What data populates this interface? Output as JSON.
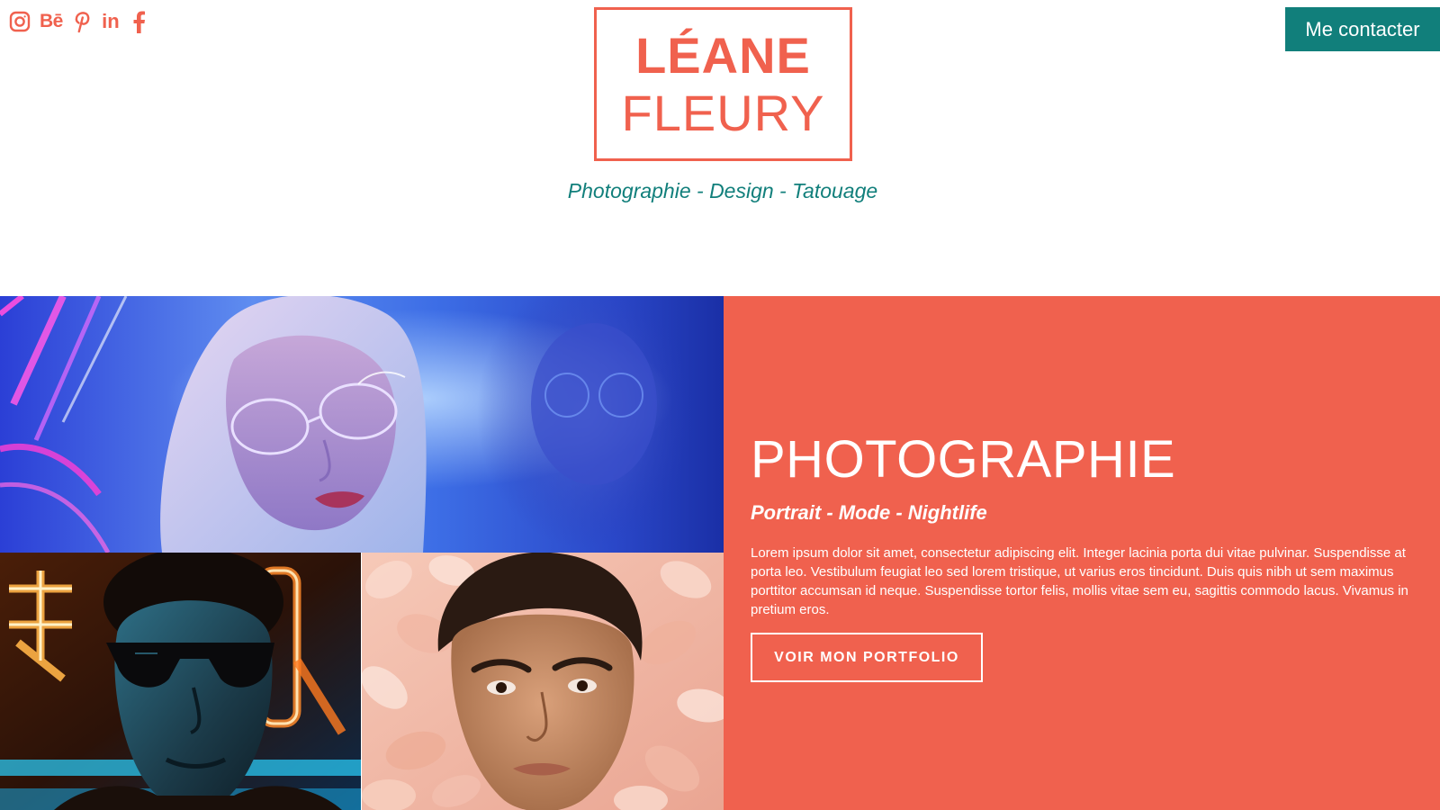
{
  "brand": {
    "name_line1": "LÉANE",
    "name_line2": "FLEURY",
    "tagline": "Photographie - Design - Tatouage"
  },
  "social": {
    "icons": [
      "instagram-icon",
      "behance-icon",
      "pinterest-icon",
      "linkedin-icon",
      "facebook-icon"
    ],
    "behance_label": "Bē",
    "linkedin_label": "in"
  },
  "header": {
    "contact_label": "Me contacter"
  },
  "section": {
    "heading": "PHOTOGRAPHIE",
    "subheading": "Portrait - Mode - Nightlife",
    "body": "Lorem ipsum dolor sit amet, consectetur adipiscing elit. Integer lacinia porta dui vitae pulvinar. Suspendisse at porta leo. Vestibulum feugiat leo sed lorem tristique, ut varius eros tincidunt. Duis quis nibh ut sem maximus porttitor accumsan id neque. Suspendisse tortor felis, mollis vitae sem eu, sagittis commodo lacus. Vivamus in pretium eros.",
    "button_label": "VOIR MON PORTFOLIO"
  },
  "colors": {
    "accent": "#f0614e",
    "teal": "#117f7b",
    "background": "#ffffff",
    "text_on_accent": "#ffffff"
  }
}
